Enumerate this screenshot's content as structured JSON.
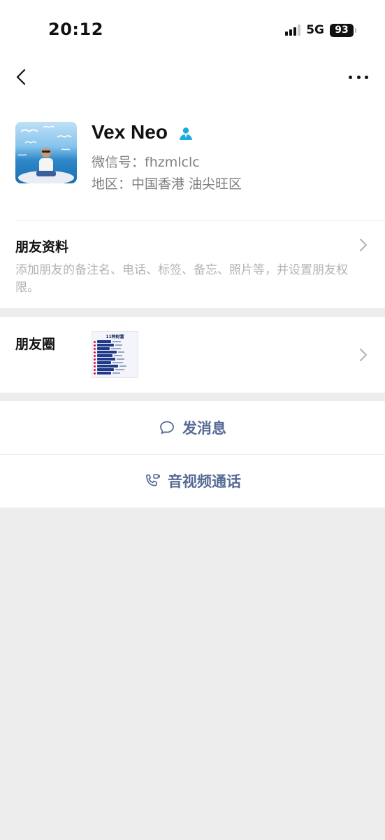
{
  "status_bar": {
    "time": "20:12",
    "network": "5G",
    "battery": "93"
  },
  "nav": {
    "back_icon": "chevron-left-icon",
    "more_icon": "more-dots-icon"
  },
  "profile": {
    "name": "Vex Neo",
    "wechat_id": "微信号：fhzmlclc",
    "region": "地区：中国香港 油尖旺区",
    "contact_icon_color": "#1aabe0"
  },
  "friend_info": {
    "title": "朋友资料",
    "description": "添加朋友的备注名、电话、标签、备忘、照片等，并设置朋友权限。"
  },
  "moments": {
    "title": "朋友圈",
    "thumbnail_title": "11种财富"
  },
  "actions": {
    "send_message": "发消息",
    "video_call": "音视频通话",
    "link_color": "#576b95"
  }
}
